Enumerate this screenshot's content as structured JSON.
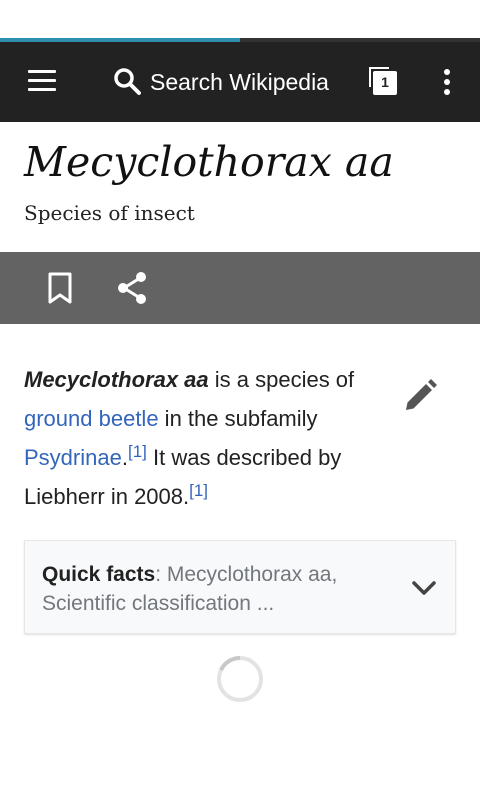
{
  "load_progress_percent": 50,
  "toolbar": {
    "menu_icon": "hamburger-menu-icon",
    "search_placeholder": "Search Wikipedia",
    "tabs_count": "1",
    "overflow_icon": "more-vertical-icon"
  },
  "article": {
    "title": "Mecyclothorax aa",
    "description": "Species of insect",
    "paragraph": {
      "lead": "Mecyclothorax aa",
      "text1": " is a species of ",
      "link1": "ground beetle",
      "text2": " in the subfamily ",
      "link2": "Psydrinae",
      "text3": ".",
      "ref1": "[1]",
      "text4": " It was described by Liebherr in 2008.",
      "ref2": "[1]"
    }
  },
  "actions": {
    "bookmark_icon": "bookmark-icon",
    "share_icon": "share-icon",
    "edit_icon": "pencil-edit-icon"
  },
  "quick_facts": {
    "label": "Quick facts",
    "summary": ": Mecyclothorax aa, Scientific classification ..."
  },
  "colors": {
    "toolbar_bg": "#222222",
    "action_bar_bg": "#636363",
    "link": "#3366bb",
    "progress": "#2f8fb0"
  }
}
